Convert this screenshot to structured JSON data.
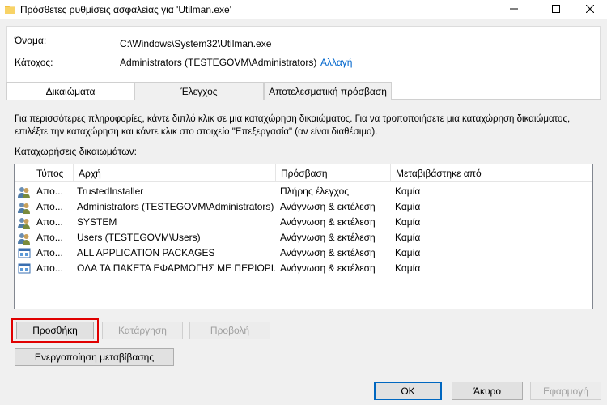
{
  "window": {
    "title": "Πρόσθετες ρυθμίσεις ασφαλείας για 'Utilman.exe'",
    "icon": "folder-icon"
  },
  "object": {
    "name_label": "Όνομα:",
    "name_value": "C:\\Windows\\System32\\Utilman.exe",
    "owner_label": "Κάτοχος:",
    "owner_value": "Administrators (TESTEGOVM\\Administrators)",
    "change_link": "Αλλαγή"
  },
  "tabs": [
    {
      "label": "Δικαιώματα",
      "active": true
    },
    {
      "label": "Έλεγχος",
      "active": false
    },
    {
      "label": "Αποτελεσματική πρόσβαση",
      "active": false
    }
  ],
  "description": "Για περισσότερες πληροφορίες, κάντε διπλό κλικ σε μια καταχώρηση δικαιώματος. Για να τροποποιήσετε μια καταχώρηση δικαιώματος, επιλέξτε την καταχώρηση και κάντε κλικ στο στοιχείο \"Επεξεργασία\" (αν είναι διαθέσιμο).",
  "entries_label": "Καταχωρήσεις δικαιωμάτων:",
  "columns": [
    "Τύπος",
    "Αρχή",
    "Πρόσβαση",
    "Μεταβιβάστηκε από"
  ],
  "rows": [
    {
      "icon": "users-icon",
      "type": "Απο...",
      "principal": "TrustedInstaller",
      "access": "Πλήρης έλεγχος",
      "inherited": "Καμία"
    },
    {
      "icon": "users-icon",
      "type": "Απο...",
      "principal": "Administrators (TESTEGOVM\\Administrators)",
      "access": "Ανάγνωση & εκτέλεση",
      "inherited": "Καμία"
    },
    {
      "icon": "users-icon",
      "type": "Απο...",
      "principal": "SYSTEM",
      "access": "Ανάγνωση & εκτέλεση",
      "inherited": "Καμία"
    },
    {
      "icon": "users-icon",
      "type": "Απο...",
      "principal": "Users (TESTEGOVM\\Users)",
      "access": "Ανάγνωση & εκτέλεση",
      "inherited": "Καμία"
    },
    {
      "icon": "package-icon",
      "type": "Απο...",
      "principal": "ALL APPLICATION PACKAGES",
      "access": "Ανάγνωση & εκτέλεση",
      "inherited": "Καμία"
    },
    {
      "icon": "package-icon",
      "type": "Απο...",
      "principal": "ΟΛΑ ΤΑ ΠΑΚΕΤΑ ΕΦΑΡΜΟΓΗΣ ΜΕ ΠΕΡΙΟΡΙ...",
      "access": "Ανάγνωση & εκτέλεση",
      "inherited": "Καμία"
    }
  ],
  "buttons": {
    "add": "Προσθήκη",
    "remove": "Κατάργηση",
    "view": "Προβολή",
    "enable_inheritance": "Ενεργοποίηση μεταβίβασης"
  },
  "footer": {
    "ok": "OK",
    "cancel": "Άκυρο",
    "apply": "Εφαρμογή"
  },
  "colors": {
    "highlight": "#e00000",
    "link": "#0066cc"
  }
}
